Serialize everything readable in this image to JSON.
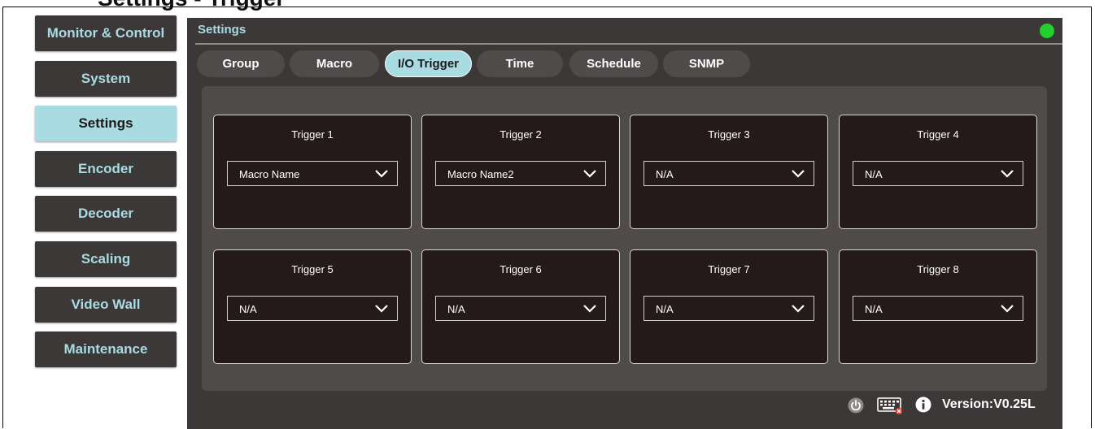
{
  "header": {
    "heading": "Settings - Trigger"
  },
  "sidebar": {
    "items": [
      {
        "label": "Monitor & Control",
        "active": false
      },
      {
        "label": "System",
        "active": false
      },
      {
        "label": "Settings",
        "active": true
      },
      {
        "label": "Encoder",
        "active": false
      },
      {
        "label": "Decoder",
        "active": false
      },
      {
        "label": "Scaling",
        "active": false
      },
      {
        "label": "Video Wall",
        "active": false
      },
      {
        "label": "Maintenance",
        "active": false
      }
    ]
  },
  "panel": {
    "title": "Settings",
    "status_color": "#21d12e",
    "tabs": [
      {
        "label": "Group",
        "active": false
      },
      {
        "label": "Macro",
        "active": false
      },
      {
        "label": "I/O Trigger",
        "active": true
      },
      {
        "label": "Time",
        "active": false
      },
      {
        "label": "Schedule",
        "active": false
      },
      {
        "label": "SNMP",
        "active": false
      }
    ],
    "triggers": [
      {
        "title": "Trigger 1",
        "value": "Macro Name"
      },
      {
        "title": "Trigger 2",
        "value": "Macro Name2"
      },
      {
        "title": "Trigger 3",
        "value": "N/A"
      },
      {
        "title": "Trigger 4",
        "value": "N/A"
      },
      {
        "title": "Trigger 5",
        "value": "N/A"
      },
      {
        "title": "Trigger 6",
        "value": "N/A"
      },
      {
        "title": "Trigger 7",
        "value": "N/A"
      },
      {
        "title": "Trigger 8",
        "value": "N/A"
      }
    ]
  },
  "footer": {
    "icons": [
      "power-icon",
      "keyboard-icon",
      "info-icon"
    ],
    "version": "Version:V0.25L"
  },
  "colors": {
    "accent": "#a9dbe2",
    "panel_bg": "#3b3837",
    "card_bg": "#231a19",
    "status_online": "#21d12e"
  }
}
